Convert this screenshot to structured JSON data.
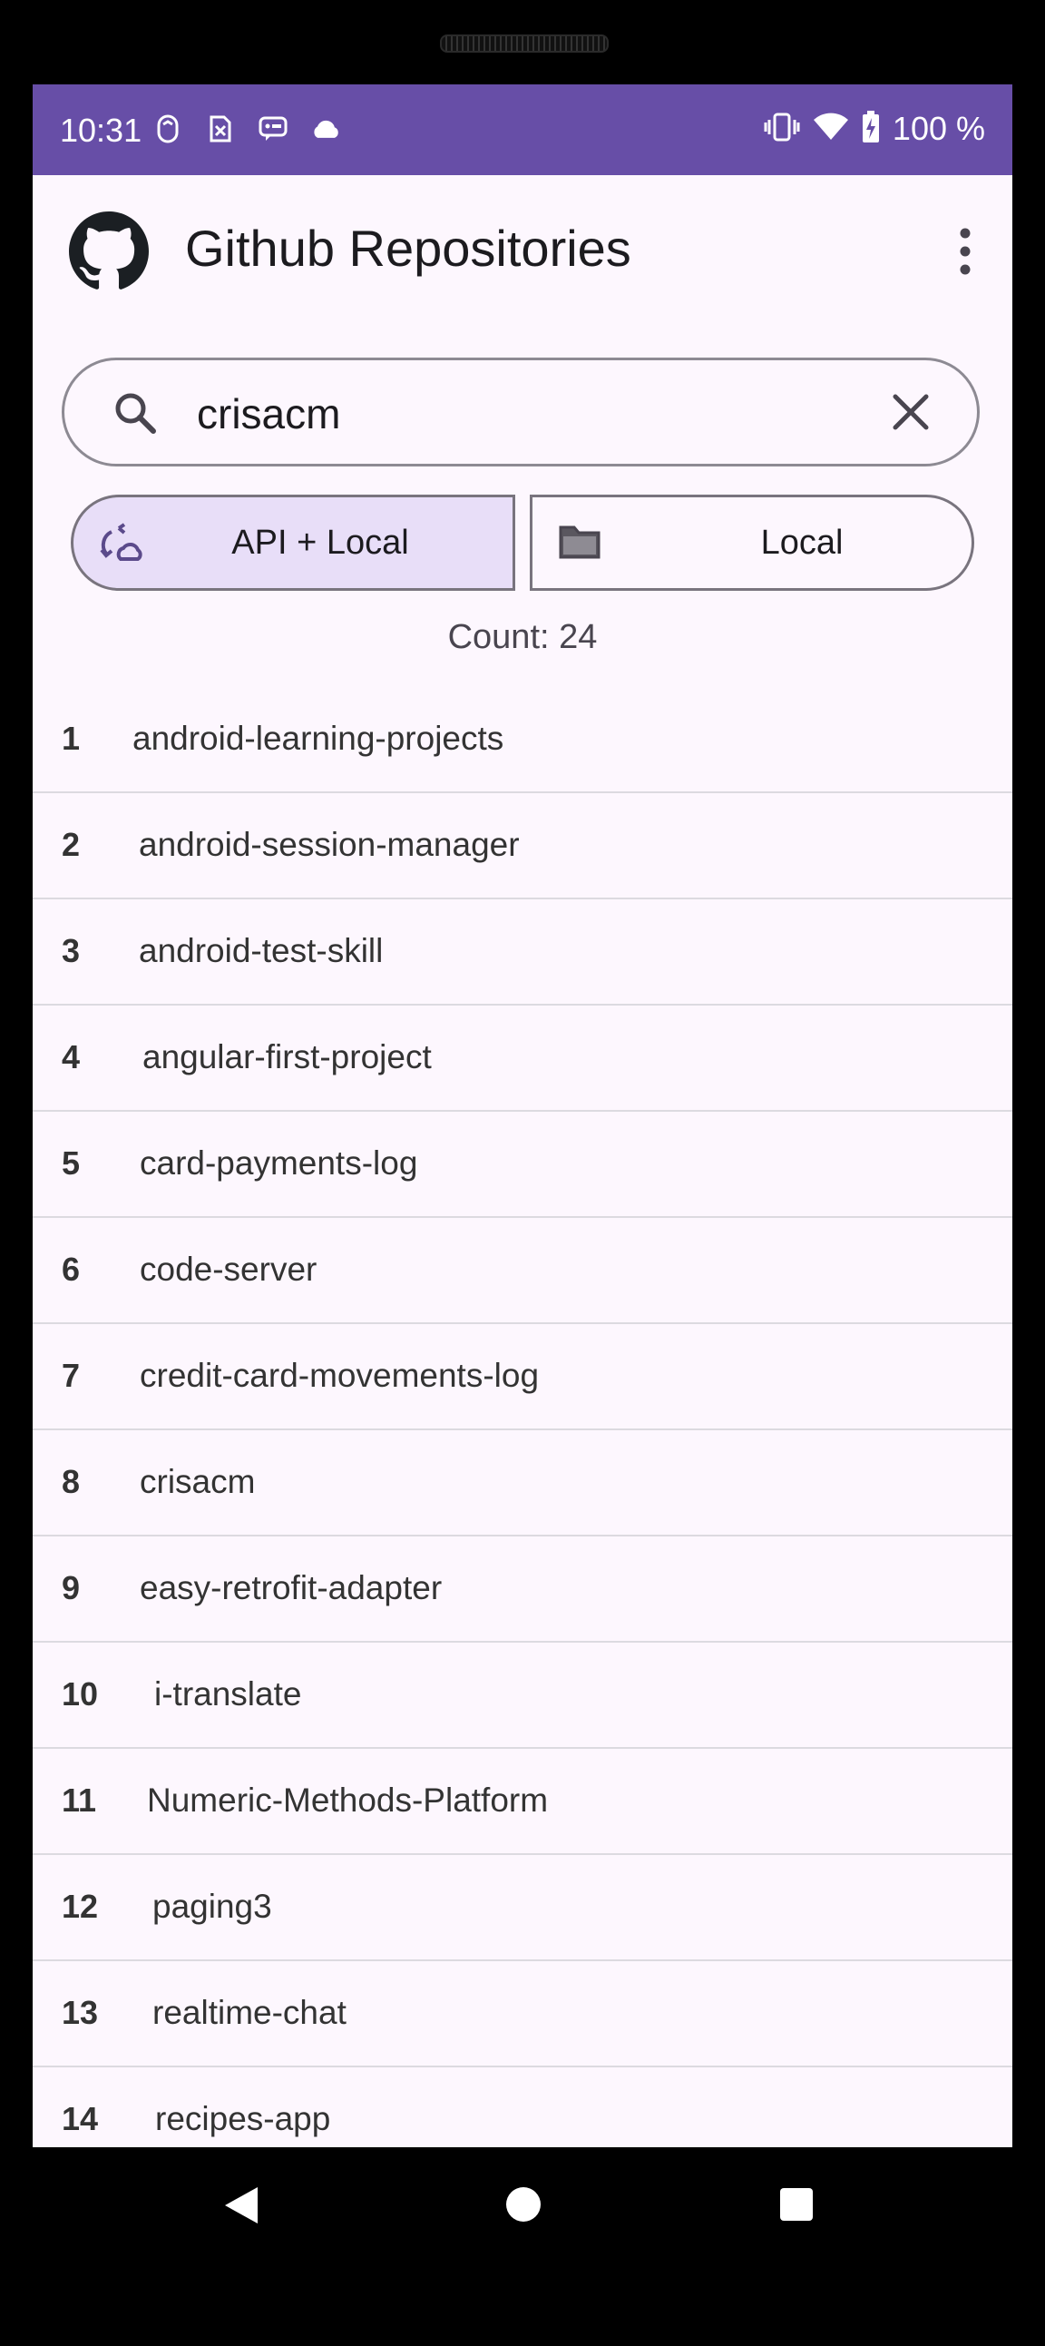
{
  "status_bar": {
    "time": "10:31",
    "battery": "100 %",
    "left_icons": [
      "gesture-icon",
      "sim-off-icon",
      "message-icon",
      "cloud-icon"
    ],
    "right_icons": [
      "vibrate-icon",
      "wifi-icon",
      "battery-charging-icon"
    ],
    "background": "#674ea7"
  },
  "app_bar": {
    "title": "Github Repositories",
    "logo": "github-icon",
    "menu_icon": "more-vert-icon"
  },
  "search": {
    "value": "crisacm",
    "icon": "search-icon",
    "clear_icon": "close-icon"
  },
  "source_toggle": {
    "options": [
      {
        "label": "API + Local",
        "icon": "sync-cloud-icon",
        "selected": true
      },
      {
        "label": "Local",
        "icon": "folder-icon",
        "selected": false
      }
    ],
    "selected_color": "#e8def8"
  },
  "count_label": "Count: 24",
  "repositories": [
    {
      "num": "1",
      "name": "android-learning-projects"
    },
    {
      "num": "2",
      "name": "android-session-manager"
    },
    {
      "num": "3",
      "name": "android-test-skill"
    },
    {
      "num": "4",
      "name": "angular-first-project"
    },
    {
      "num": "5",
      "name": "card-payments-log"
    },
    {
      "num": "6",
      "name": "code-server"
    },
    {
      "num": "7",
      "name": "credit-card-movements-log"
    },
    {
      "num": "8",
      "name": "crisacm"
    },
    {
      "num": "9",
      "name": "easy-retrofit-adapter"
    },
    {
      "num": "10",
      "name": "i-translate"
    },
    {
      "num": "11",
      "name": "Numeric-Methods-Platform"
    },
    {
      "num": "12",
      "name": "paging3"
    },
    {
      "num": "13",
      "name": "realtime-chat"
    },
    {
      "num": "14",
      "name": "recipes-app"
    }
  ],
  "nav_bar": {
    "buttons": [
      "back-icon",
      "home-icon",
      "recents-icon"
    ]
  }
}
